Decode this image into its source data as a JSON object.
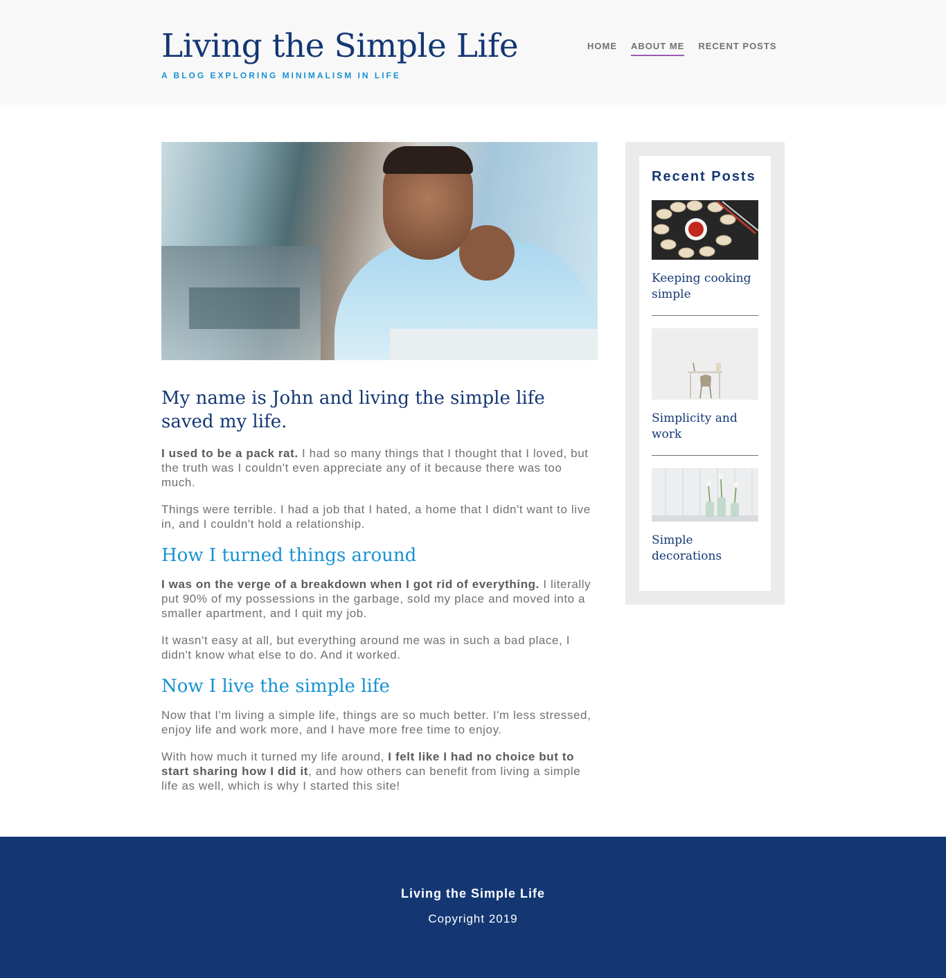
{
  "header": {
    "title": "Living the Simple Life",
    "subtitle": "A blog exploring minimalism in life",
    "nav": [
      {
        "label": "Home",
        "active": false
      },
      {
        "label": "About me",
        "active": true
      },
      {
        "label": "Recent posts",
        "active": false
      }
    ]
  },
  "main": {
    "hero_image": "portrait-image",
    "article_title": "My name is John and living the simple life saved my life.",
    "intro_p1_bold": "I used to be a pack rat.",
    "intro_p1_rest": " I had so many things that I thought that I loved, but the truth was I couldn't even appreciate any of it because there was too much.",
    "intro_p2": "Things were terrible. I had a job that I hated, a home that I didn't want to live in, and I couldn't hold a relationship.",
    "section1_title": "How I turned things around",
    "s1_p1_bold": "I was on the verge of a breakdown when I got rid of everything.",
    "s1_p1_rest": " I literally put 90% of my possessions in the garbage, sold my place and moved into a smaller apartment, and I quit my job.",
    "s1_p2": "It wasn't easy at all, but everything around me was in such a bad place, I didn't know what else to do. And it worked.",
    "section2_title": "Now I live the simple life",
    "s2_p1": "Now that I'm living a simple life, things are so much better. I'm less stressed, enjoy life and work more, and I have more free time to enjoy.",
    "s2_p2_start": "With how much it turned my life around, ",
    "s2_p2_bold": "I felt like I had no choice but to start sharing how I did it",
    "s2_p2_end": ", and how others can benefit from living a simple life as well, which is why I started this site!"
  },
  "sidebar": {
    "title": "Recent Posts",
    "posts": [
      {
        "title": "Keeping cooking simple",
        "image": "dumplings-image"
      },
      {
        "title": "Simplicity and work",
        "image": "desk-chair-image"
      },
      {
        "title": "Simple decorations",
        "image": "vases-image"
      }
    ]
  },
  "footer": {
    "title": "Living the Simple Life",
    "copyright": "Copyright 2019"
  },
  "colors": {
    "primary": "#143774",
    "accent": "#1792d2",
    "nav_underline": "#9b59b6",
    "text": "#707070"
  }
}
